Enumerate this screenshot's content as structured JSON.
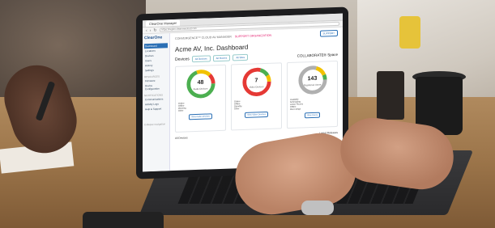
{
  "browser": {
    "tab_label": "ClearOne Manager",
    "url": "https://region.clearonecloud.com"
  },
  "app": {
    "logo": "ClearOne",
    "product": "CONVERGENCE™ CLOUD AV MANAGER",
    "support_link": "SUPPORT ORGANIZATION",
    "support_button": "SUPPORT",
    "page_title": "Acme AV, Inc. Dashboard",
    "devices_label": "Devices",
    "filters": [
      "All Devices",
      "All Rooms",
      "All Sites"
    ],
    "collab_label": "COLLABORATE® Space"
  },
  "sidebar": {
    "items": [
      {
        "label": "Dashboard",
        "active": true
      },
      {
        "label": "Locations"
      },
      {
        "label": "Devices"
      },
      {
        "label": "Users"
      },
      {
        "label": "History"
      },
      {
        "label": "Settings"
      }
    ],
    "sections": [
      {
        "head": "RESOURCES",
        "items": [
          "Firmware",
          "Device Configuration"
        ]
      },
      {
        "head": "NOTIFICATIONS",
        "items": [
          "Communications",
          "Activity Logs",
          "Help & Support"
        ]
      }
    ],
    "footer": "Collapse navigation"
  },
  "cards": [
    {
      "count": "48",
      "label": "Audio Devices",
      "ring": [
        "#4caf50",
        "#f2c200",
        "#e53935"
      ],
      "legend": [
        "Online",
        "Offline",
        "Warning",
        "Other"
      ],
      "button": "View Audio Devices"
    },
    {
      "count": "7",
      "label": "Video Devices",
      "ring": [
        "#e53935",
        "#4caf50",
        "#f2c200"
      ],
      "legend": [
        "Online",
        "Offline",
        "Standby",
        "Other"
      ],
      "button": "View Video Devices"
    },
    {
      "count": "143",
      "label": "Registered Users",
      "ring": [
        "#b0b0b0",
        "#f2c200",
        "#4caf50"
      ],
      "legend": [
        "Available",
        "Scheduling",
        "Active Rooms",
        "Offline",
        "Recordings"
      ],
      "button": "View Users"
    }
  ],
  "bottom": {
    "left": "All Devices",
    "right": "Latest Releases"
  }
}
